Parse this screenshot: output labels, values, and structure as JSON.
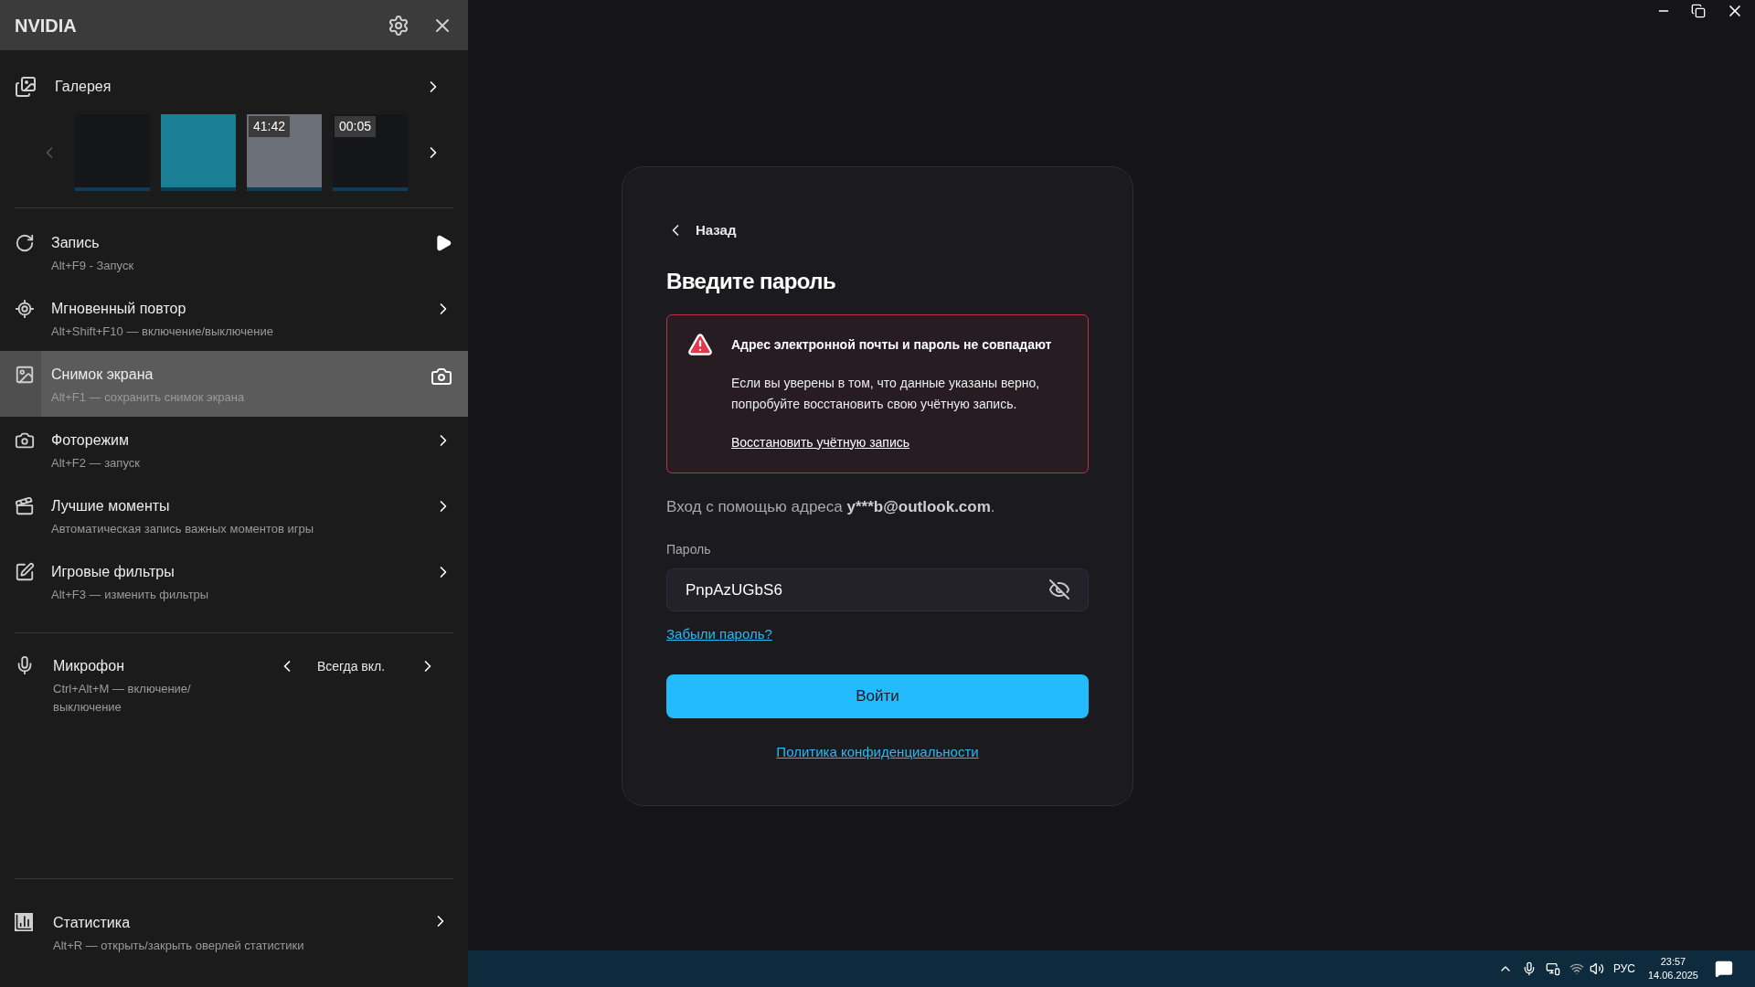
{
  "sidebar": {
    "title": "NVIDIA",
    "gallery": {
      "label": "Галерея",
      "prev_enabled": false,
      "next_enabled": true,
      "thumbnails": [
        {
          "kind": "screenshot"
        },
        {
          "kind": "screenshot"
        },
        {
          "kind": "video",
          "duration": "41:42"
        },
        {
          "kind": "video",
          "duration": "00:05"
        }
      ]
    },
    "items": [
      {
        "kind": "play",
        "title": "Запись",
        "shortcut": "Alt+F9 - Запуск",
        "selected": false
      },
      {
        "kind": "chevron",
        "title": "Мгновенный повтор",
        "shortcut": "Alt+Shift+F10 — включение/выключение",
        "selected": false
      },
      {
        "kind": "camera",
        "title": "Снимок экрана",
        "shortcut": "Alt+F1 — сохранить снимок экрана",
        "selected": true
      },
      {
        "kind": "chevron",
        "title": "Фоторежим",
        "shortcut": "Alt+F2 — запуск",
        "selected": false
      },
      {
        "kind": "chevron",
        "title": "Лучшие моменты",
        "shortcut": "Автоматическая запись важных моментов игры",
        "selected": false
      },
      {
        "kind": "chevron",
        "title": "Игровые фильтры",
        "shortcut": "Alt+F3 — изменить фильтры",
        "selected": false
      }
    ],
    "microphone": {
      "title": "Микрофон",
      "shortcut": "Ctrl+Alt+M — включение/ выключение",
      "value": "Всегда вкл."
    },
    "statistics": {
      "title": "Статистика",
      "shortcut": "Alt+R — открыть/закрыть оверлей статистики"
    }
  },
  "login": {
    "back": "Назад",
    "title": "Введите пароль",
    "alert": {
      "title": "Адрес электронной почты и пароль не совпадают",
      "body": "Если вы уверены в том, что данные указаны верно, попробуйте восстановить свою учётную запись.",
      "link": "Восстановить учётную запись"
    },
    "signin_prefix": "Вход с помощью адреса",
    "email": "y***b@outlook.com",
    "signin_suffix": ".",
    "password_label": "Пароль",
    "password_value": "PnpAzUGbS6",
    "forgot": "Забыли пароль?",
    "submit": "Войти",
    "privacy": "Политика конфиденциальности"
  },
  "taskbar": {
    "language": "РУС",
    "time": "23:57",
    "date": "14.06.2025"
  }
}
